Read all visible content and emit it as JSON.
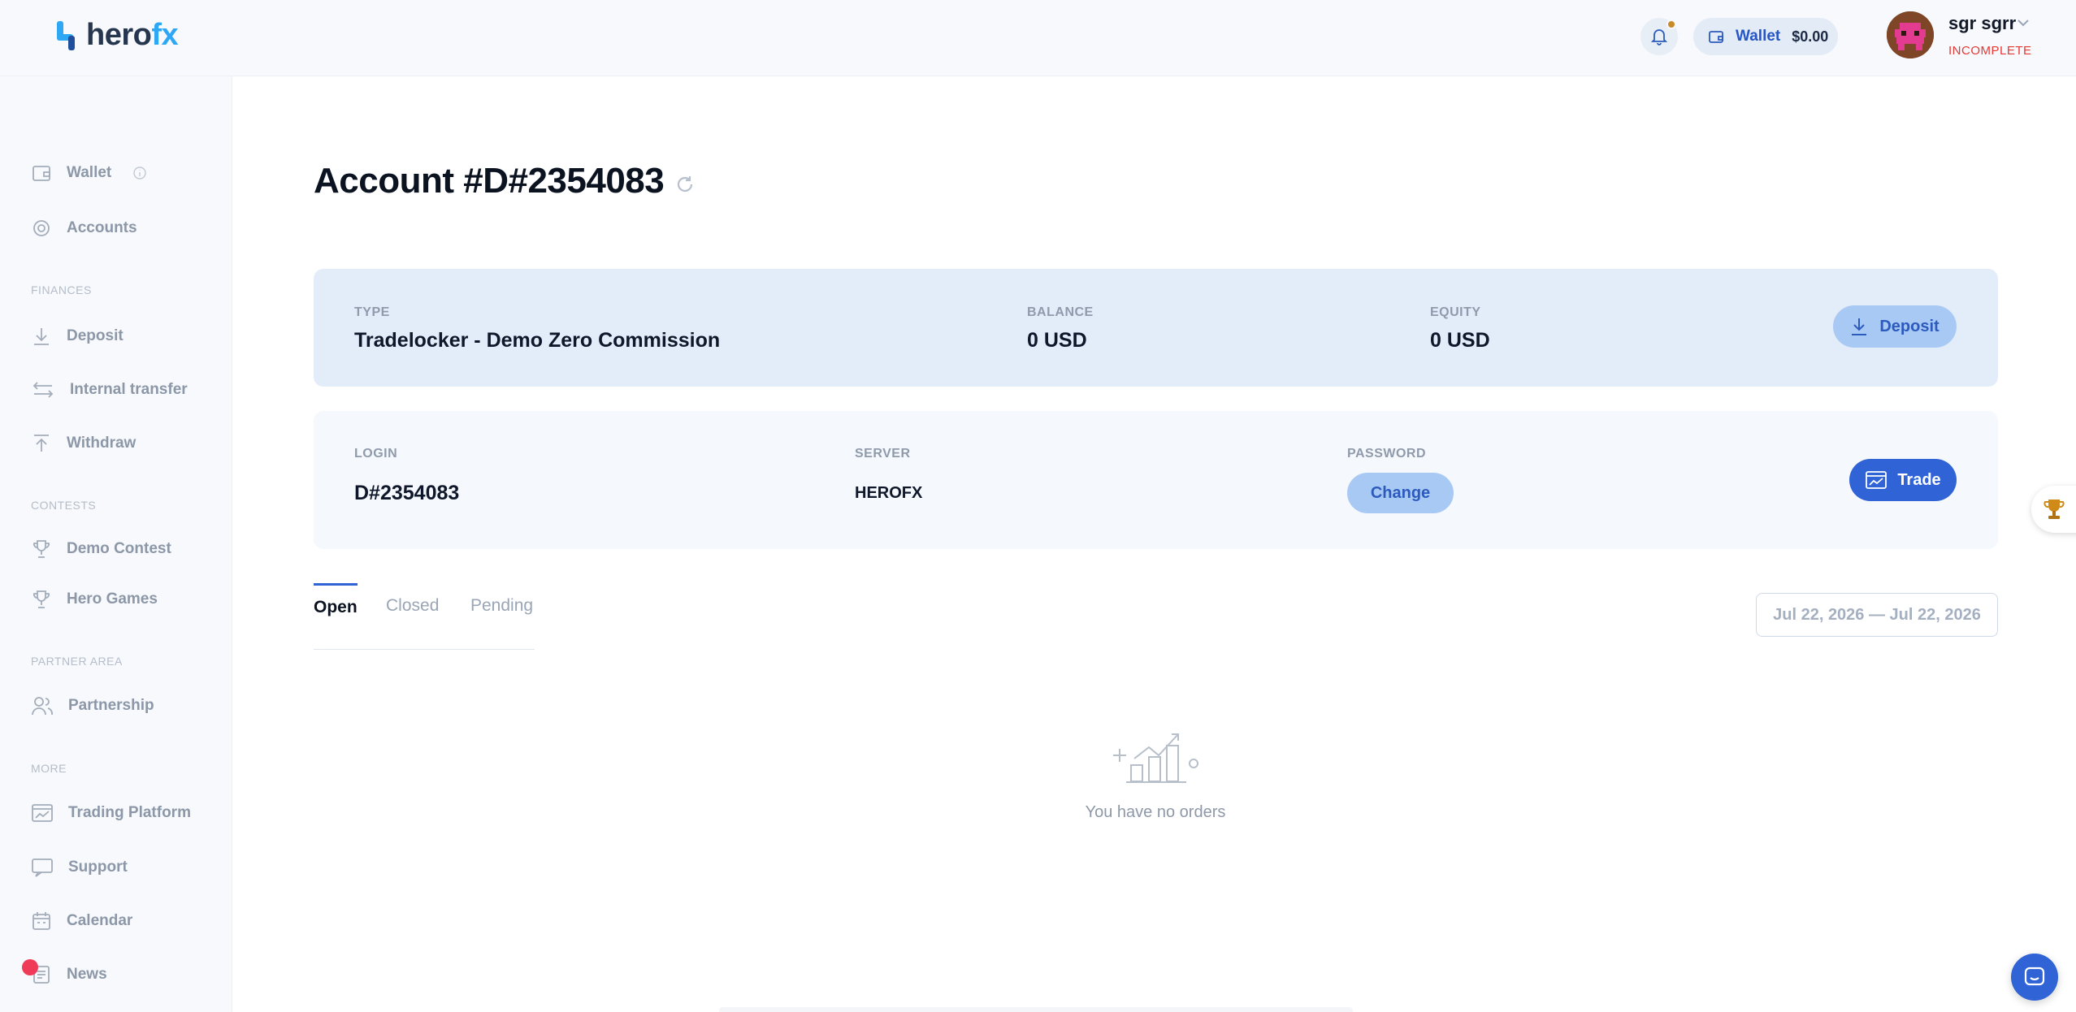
{
  "header": {
    "logo_text_a": "hero",
    "logo_text_b": "fx",
    "wallet_label": "Wallet",
    "wallet_value": "$0.00",
    "user_name": "sgr sgrr",
    "user_status": "INCOMPLETE"
  },
  "sidebar": {
    "items": [
      {
        "label": "Wallet",
        "icon": "wallet-icon"
      },
      {
        "label": "Accounts",
        "icon": "accounts-icon"
      },
      {
        "label": "Deposit",
        "icon": "deposit-icon"
      },
      {
        "label": "Internal transfer",
        "icon": "transfer-icon"
      },
      {
        "label": "Withdraw",
        "icon": "withdraw-icon"
      },
      {
        "label": "Demo Contest",
        "icon": "trophy-icon"
      },
      {
        "label": "Hero Games",
        "icon": "trophy-icon"
      },
      {
        "label": "Partnership",
        "icon": "users-icon"
      },
      {
        "label": "Trading Platform",
        "icon": "platform-icon"
      },
      {
        "label": "Support",
        "icon": "support-icon"
      },
      {
        "label": "Calendar",
        "icon": "calendar-icon"
      },
      {
        "label": "News",
        "icon": "news-icon"
      }
    ],
    "sections": {
      "finances": "FINANCES",
      "contests": "CONTESTS",
      "partner": "PARTNER AREA",
      "more": "MORE"
    }
  },
  "main": {
    "title": "Account #D#2354083",
    "summary": {
      "type_label": "TYPE",
      "type_value": "Tradelocker - Demo Zero Commission",
      "balance_label": "BALANCE",
      "balance_value": "0 USD",
      "equity_label": "EQUITY",
      "equity_value": "0 USD",
      "deposit_button": "Deposit"
    },
    "credentials": {
      "login_label": "LOGIN",
      "login_value": "D#2354083",
      "server_label": "SERVER",
      "server_value": "HEROFX",
      "password_label": "PASSWORD",
      "change_button": "Change",
      "trade_button": "Trade"
    },
    "tabs": [
      "Open",
      "Closed",
      "Pending"
    ],
    "active_tab": "Open",
    "date_range": "Jul 22, 2026 — Jul 22, 2026",
    "empty_message": "You have no orders"
  },
  "colors": {
    "accent": "#2f63d6",
    "light_accent": "#a9c9f5",
    "status_incomplete": "#e53935",
    "card_blue": "#e3edfa"
  }
}
